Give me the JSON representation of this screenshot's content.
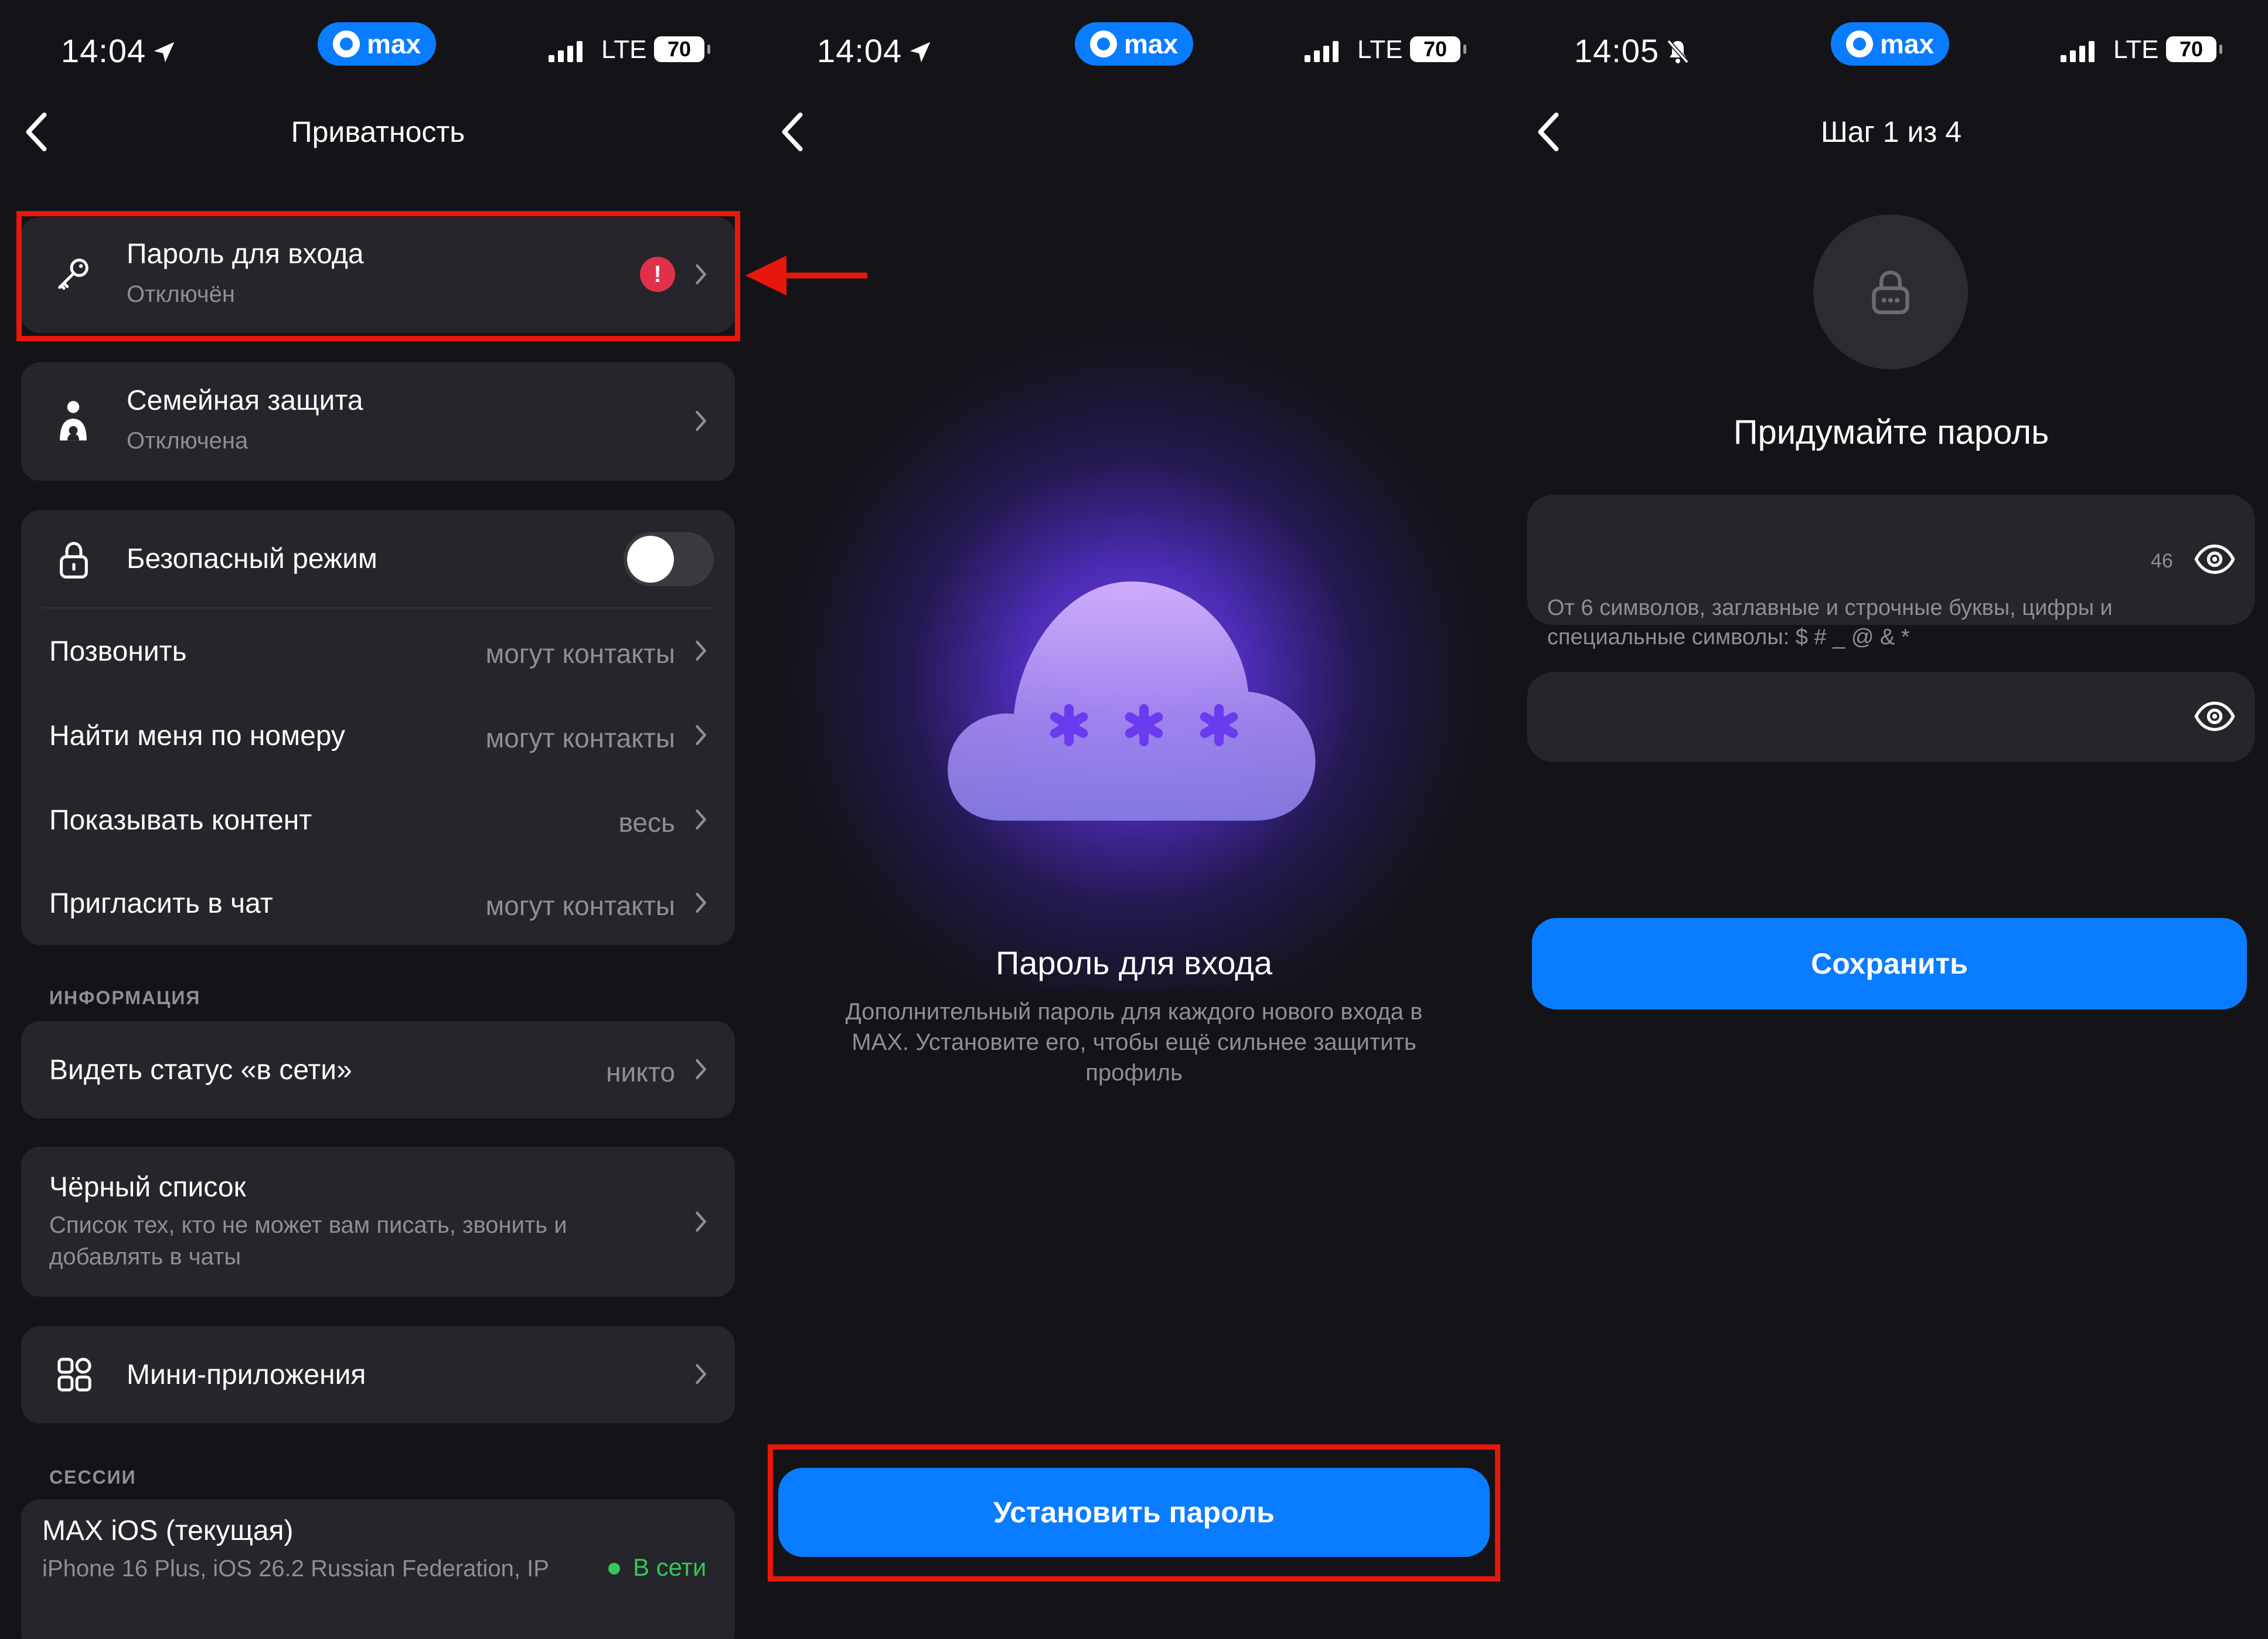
{
  "status_bars": [
    {
      "time": "14:04",
      "carrier_pill": "max",
      "network": "LTE",
      "battery": "70"
    },
    {
      "time": "14:04",
      "carrier_pill": "max",
      "network": "LTE",
      "battery": "70"
    },
    {
      "time": "14:05",
      "carrier_pill": "max",
      "network": "LTE",
      "battery": "70"
    }
  ],
  "privacy": {
    "title": "Приватность",
    "login_password": {
      "label": "Пароль для входа",
      "status": "Отключён",
      "alert": "!"
    },
    "family_protection": {
      "label": "Семейная защита",
      "status": "Отключена"
    },
    "safe_mode": {
      "label": "Безопасный режим",
      "enabled": false
    },
    "rows": [
      {
        "label": "Позвонить",
        "value": "могут контакты"
      },
      {
        "label": "Найти меня по номеру",
        "value": "могут контакты"
      },
      {
        "label": "Показывать контент",
        "value": "весь"
      },
      {
        "label": "Пригласить в чат",
        "value": "могут контакты"
      }
    ],
    "info_header": "ИНФОРМАЦИЯ",
    "online_status": {
      "label": "Видеть статус «в сети»",
      "value": "никто"
    },
    "blacklist": {
      "label": "Чёрный список",
      "desc_line1": "Список тех, кто не может вам писать, звонить и",
      "desc_line2": "добавлять в чаты"
    },
    "mini_apps": {
      "label": "Мини-приложения"
    },
    "sessions_header": "СЕССИИ",
    "session": {
      "name": "MAX iOS (текущая)",
      "device": "iPhone 16 Plus, iOS 26.2 Russian Federation, IP",
      "status": "В сети"
    }
  },
  "intro": {
    "title": "Пароль для входа",
    "desc_line1": "Дополнительный пароль для каждого нового входа в",
    "desc_line2": "MAX. Установите его, чтобы ещё сильнее защитить",
    "desc_line3": "профиль",
    "button": "Установить пароль"
  },
  "create_password": {
    "step": "Шаг 1 из 4",
    "heading": "Придумайте пароль",
    "counter": "46",
    "hint_line1": "От 6 символов, заглавные и строчные буквы, цифры и",
    "hint_line2": "специальные символы: $ # _ @ & *",
    "save_button": "Сохранить"
  },
  "colors": {
    "background": "#141418",
    "card": "#25252b",
    "accent": "#0a7cff",
    "annotation_red": "#e8170b",
    "alert_red": "#e0314b",
    "online_green": "#34c759"
  }
}
